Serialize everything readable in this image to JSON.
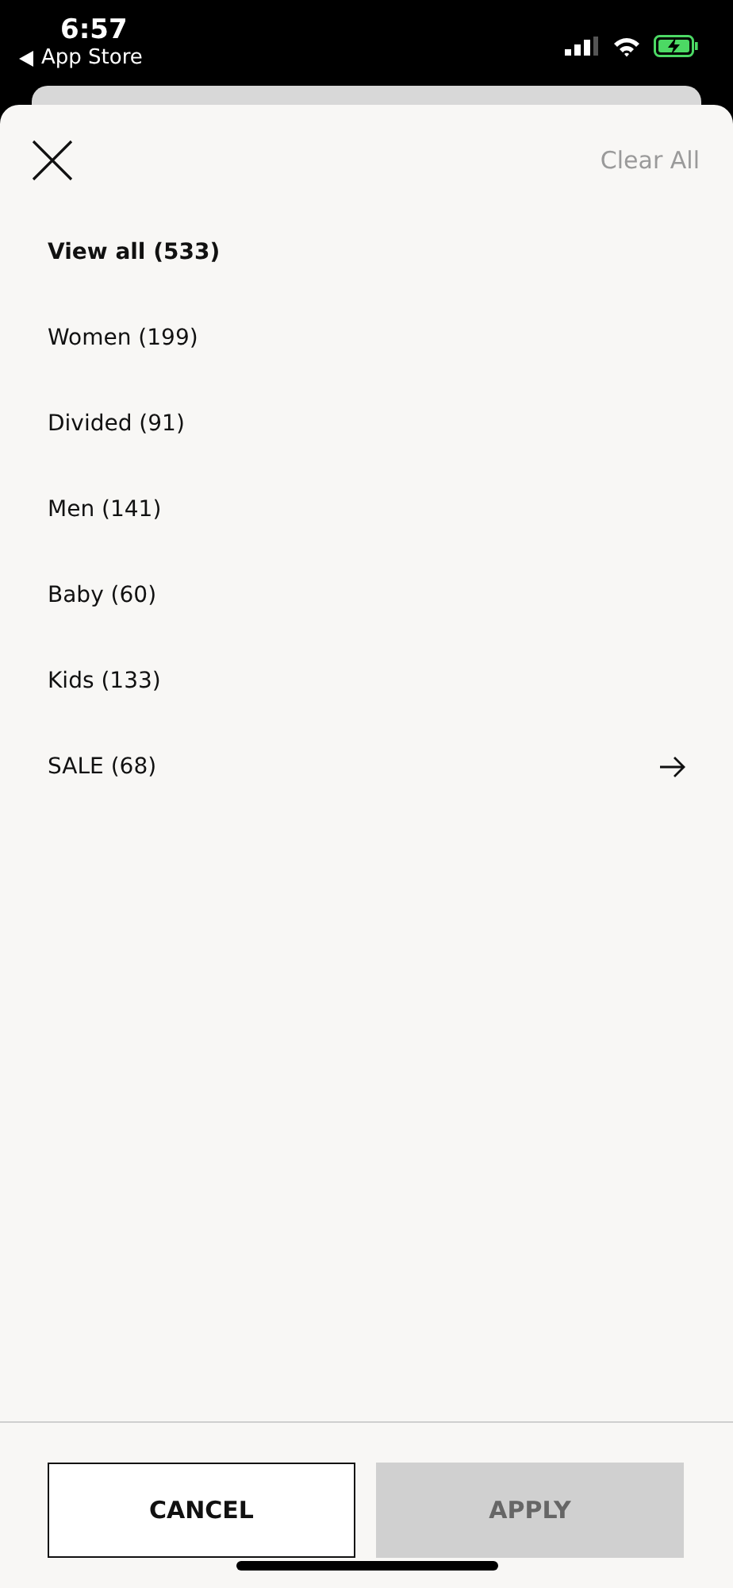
{
  "status_bar": {
    "time": "6:57",
    "back_label": "App Store"
  },
  "header": {
    "clear_label": "Clear All"
  },
  "categories": [
    {
      "label": "View all (533)",
      "selected": true,
      "has_arrow": false
    },
    {
      "label": "Women (199)",
      "selected": false,
      "has_arrow": false
    },
    {
      "label": "Divided (91)",
      "selected": false,
      "has_arrow": false
    },
    {
      "label": "Men (141)",
      "selected": false,
      "has_arrow": false
    },
    {
      "label": "Baby (60)",
      "selected": false,
      "has_arrow": false
    },
    {
      "label": "Kids (133)",
      "selected": false,
      "has_arrow": false
    },
    {
      "label": "SALE (68)",
      "selected": false,
      "has_arrow": true
    }
  ],
  "buttons": {
    "cancel": "CANCEL",
    "apply": {
      "label": "APPLY",
      "disabled": true
    }
  }
}
